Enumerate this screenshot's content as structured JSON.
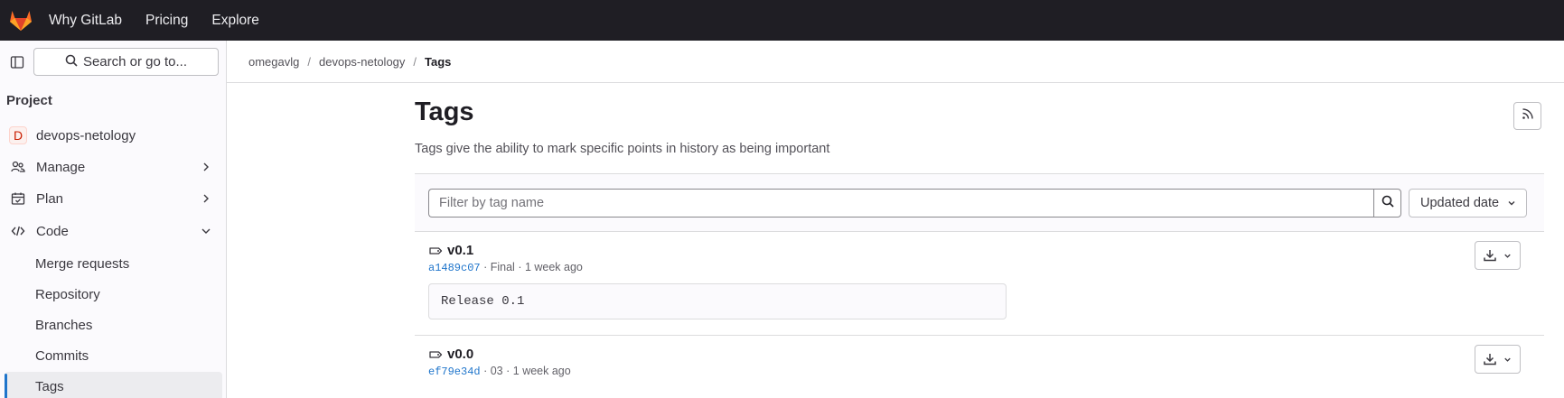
{
  "topbar": {
    "links": [
      "Why GitLab",
      "Pricing",
      "Explore"
    ]
  },
  "sidebar": {
    "search_label": "Search or go to...",
    "section_title": "Project",
    "project_initial": "D",
    "project_name": "devops-netology",
    "items": [
      {
        "label": "Manage",
        "icon": "users-icon"
      },
      {
        "label": "Plan",
        "icon": "calendar-icon"
      },
      {
        "label": "Code",
        "icon": "code-icon"
      }
    ],
    "code_subitems": [
      "Merge requests",
      "Repository",
      "Branches",
      "Commits",
      "Tags"
    ],
    "active_subitem": "Tags"
  },
  "breadcrumb": {
    "items": [
      "omegavlg",
      "devops-netology",
      "Tags"
    ]
  },
  "main": {
    "title": "Tags",
    "description": "Tags give the ability to mark specific points in history as being important",
    "filter_placeholder": "Filter by tag name",
    "sort_label": "Updated date"
  },
  "tags": [
    {
      "name": "v0.1",
      "sha": "a1489c07",
      "message": "Final",
      "time": "1 week ago",
      "release": "Release 0.1"
    },
    {
      "name": "v0.0",
      "sha": "ef79e34d",
      "message": "03",
      "time": "1 week ago",
      "release": ""
    }
  ],
  "colors": {
    "topbar_bg": "#1f1e24",
    "link_blue": "#1f75cb",
    "active_indicator": "#1f75cb"
  }
}
